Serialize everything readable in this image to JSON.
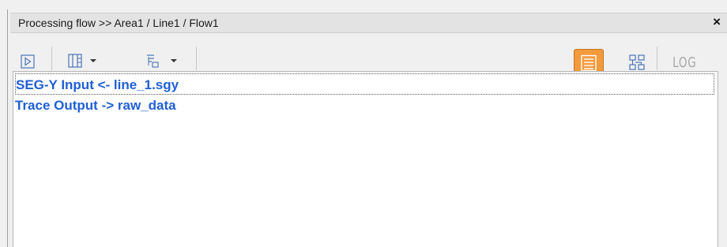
{
  "window": {
    "title": "Processing flow >> Area1 / Line1 / Flow1",
    "close_label": "×"
  },
  "toolbar": {
    "run_icon": "play-icon",
    "columns_icon": "columns-icon",
    "tree_icon": "tree-icon",
    "list_view_icon": "list-view-icon",
    "flowchart_icon": "flowchart-icon",
    "log_label": "LOG",
    "active_color": "#f29a3c"
  },
  "flow": {
    "items": [
      {
        "label": "SEG-Y Input <- line_1.sgy",
        "selected": true
      },
      {
        "label": "Trace Output -> raw_data",
        "selected": false
      }
    ],
    "item_color": "#1f5fd6"
  }
}
